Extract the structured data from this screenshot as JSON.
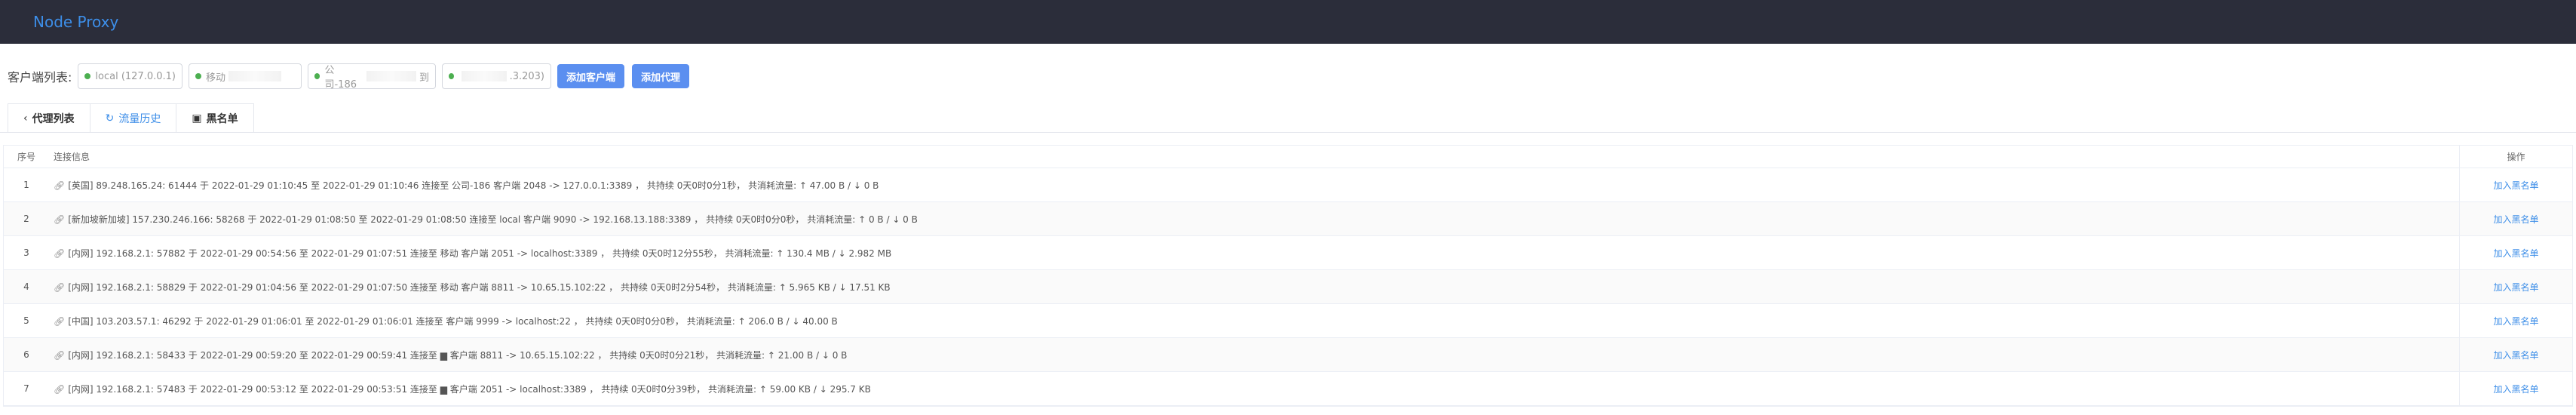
{
  "app": {
    "title": "Node Proxy"
  },
  "clients_bar": {
    "label": "客户端列表:",
    "clients": [
      {
        "name": "local (127.0.0.1)",
        "status_color": "#4caf50"
      },
      {
        "name": "移动",
        "status_color": "#4caf50"
      },
      {
        "name": "公司-186",
        "suffix": "到",
        "status_color": "#4caf50"
      },
      {
        "name": "",
        "suffix": ".3.203)",
        "status_color": "#4caf50"
      }
    ],
    "add_client_label": "添加客户端",
    "add_proxy_label": "添加代理"
  },
  "tabs": [
    {
      "label": "代理列表",
      "icon": "share-icon"
    },
    {
      "label": "流量历史",
      "icon": "refresh-icon",
      "active": true
    },
    {
      "label": "黑名单",
      "icon": "monitor-icon"
    }
  ],
  "table": {
    "headers": {
      "index": "序号",
      "info": "连接信息",
      "action": "操作"
    },
    "action_label": "加入黑名单",
    "rows": [
      {
        "index": "1",
        "info": "[英国] 89.248.165.24: 61444 于 2022-01-29 01:10:45 至 2022-01-29 01:10:46 连接至 公司-186 客户端 2048 -> 127.0.0.1:3389 ， 共持续 0天0时0分1秒，  共消耗流量: ↑ 47.00 B / ↓ 0 B"
      },
      {
        "index": "2",
        "info": "[新加坡新加坡] 157.230.246.166: 58268 于 2022-01-29 01:08:50 至 2022-01-29 01:08:50 连接至 local 客户端 9090 -> 192.168.13.188:3389 ， 共持续 0天0时0分0秒，  共消耗流量: ↑ 0 B / ↓ 0 B"
      },
      {
        "index": "3",
        "info": "[内网] 192.168.2.1: 57882 于 2022-01-29 00:54:56 至 2022-01-29 01:07:51 连接至 移动 客户端 2051 -> localhost:3389 ， 共持续 0天0时12分55秒，  共消耗流量: ↑ 130.4 MB / ↓ 2.982 MB"
      },
      {
        "index": "4",
        "info": "[内网] 192.168.2.1: 58829 于 2022-01-29 01:04:56 至 2022-01-29 01:07:50 连接至 移动 客户端 8811 -> 10.65.15.102:22 ， 共持续 0天0时2分54秒，  共消耗流量: ↑ 5.965 KB / ↓ 17.51 KB"
      },
      {
        "index": "5",
        "info": "[中国] 103.203.57.1: 46292 于 2022-01-29 01:06:01 至 2022-01-29 01:06:01 连接至          客户端 9999 -> localhost:22 ， 共持续 0天0时0分0秒，  共消耗流量: ↑ 206.0 B / ↓ 40.00 B"
      },
      {
        "index": "6",
        "info": "[内网] 192.168.2.1: 58433 于 2022-01-29 00:59:20 至 2022-01-29 00:59:41 连接至 ▆   客户端 8811 -> 10.65.15.102:22 ， 共持续 0天0时0分21秒，  共消耗流量: ↑ 21.00 B / ↓ 0 B"
      },
      {
        "index": "7",
        "info": "[内网] 192.168.2.1: 57483 于 2022-01-29 00:53:12 至 2022-01-29 00:53:51 连接至 ▆ 客户端 2051 -> localhost:3389 ， 共持续 0天0时0分39秒，  共消耗流量: ↑ 59.00 KB / ↓ 295.7 KB"
      }
    ]
  }
}
